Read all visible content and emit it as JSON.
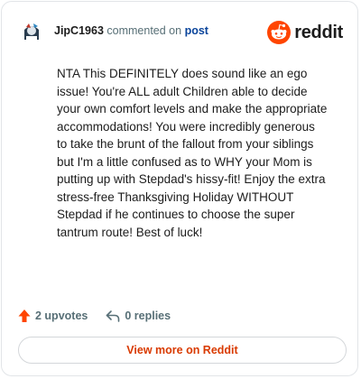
{
  "header": {
    "username": "JipC1963",
    "action_text": "commented on",
    "post_link": "post",
    "brand": "reddit"
  },
  "comment": {
    "text": "NTA This DEFINITELY does sound like an ego issue! You're ALL adult Children able to decide your own comfort levels and make the appropriate accommodations! You were incredibly generous to take the brunt of the fallout from your siblings but I'm a little confused as to WHY your Mom is putting up with Stepdad's hissy-fit! Enjoy the extra stress-free Thanksgiving Holiday WITHOUT Stepdad if he continues to choose the super tantrum route! Best of luck!"
  },
  "actions": {
    "upvotes": "2 upvotes",
    "replies": "0 replies"
  },
  "footer": {
    "view_more": "View more on Reddit"
  },
  "icons": {
    "upvote": "arrow-up-icon",
    "reply": "reply-icon",
    "brand": "reddit-logo-icon"
  },
  "colors": {
    "brand_orange": "#ff4500",
    "link_blue": "#0a449b",
    "view_more_text": "#d93a00",
    "muted_text": "#576f76"
  }
}
